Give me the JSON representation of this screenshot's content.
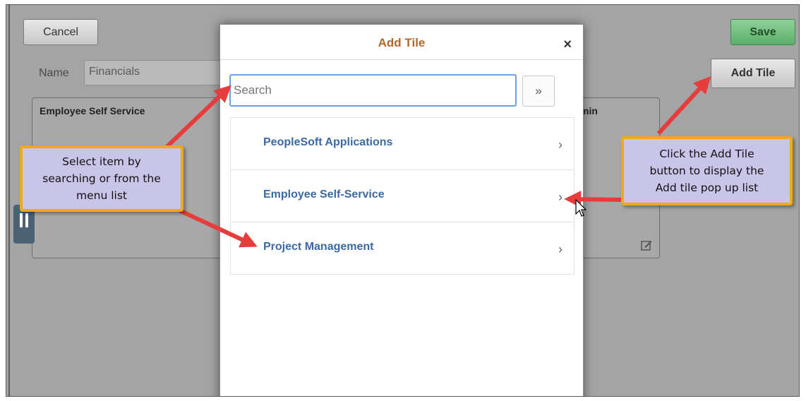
{
  "toolbar": {
    "cancel_label": "Cancel",
    "save_label": "Save",
    "add_tile_label": "Add Tile"
  },
  "form": {
    "name_label": "Name",
    "name_value": "Financials"
  },
  "tiles": [
    {
      "title": "Employee Self Service"
    },
    {
      "title": "min"
    }
  ],
  "modal": {
    "title": "Add Tile",
    "close_glyph": "×",
    "search_placeholder": "Search",
    "search_button_glyph": "»",
    "menu": [
      {
        "label": "PeopleSoft Applications",
        "chevron": "›"
      },
      {
        "label": "Employee Self-Service",
        "chevron": "›"
      },
      {
        "label": "Project Management",
        "chevron": "›"
      }
    ]
  },
  "callouts": {
    "left": {
      "lines": [
        "Select item by",
        "searching or from the",
        "menu list"
      ]
    },
    "right": {
      "lines": [
        "Click the Add Tile",
        "button to display the",
        "Add tile pop up list"
      ]
    }
  },
  "colors": {
    "modal_title": "#b4662b",
    "menu_link": "#3c6aa0",
    "callout_fill": "#c9c5e8",
    "callout_border": "#f0a918",
    "arrow": "#e63c3c",
    "save_button": "#5cae6a"
  }
}
